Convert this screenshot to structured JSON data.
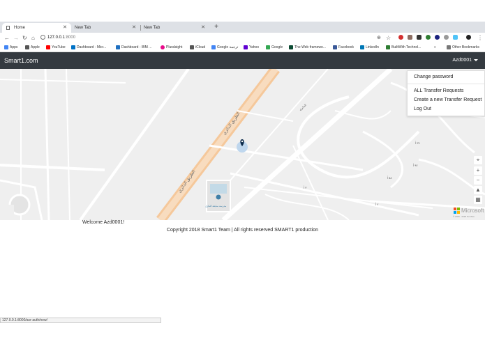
{
  "browser": {
    "tabs": [
      {
        "title": "Home",
        "active": true
      },
      {
        "title": "New Tab",
        "active": false
      },
      {
        "title": "New Tab",
        "active": false
      }
    ],
    "new_tab_symbol": "+",
    "url_host": "127.0.0.1",
    "url_port": ":8000",
    "bookmarks": [
      {
        "label": "Apps",
        "icon": "apps-grid-icon",
        "color": "#4285f4"
      },
      {
        "label": "Apple",
        "icon": "apple-icon",
        "color": "#555555"
      },
      {
        "label": "YouTube",
        "icon": "youtube-icon",
        "color": "#ff0000"
      },
      {
        "label": "Dashboard - Micr...",
        "icon": "azure-icon",
        "color": "#0072c6"
      },
      {
        "label": "Dashboard - IBM ...",
        "icon": "ibm-icon",
        "color": "#1f70c1"
      },
      {
        "label": "Pluralsight",
        "icon": "pluralsight-icon",
        "color": "#e80a89"
      },
      {
        "label": "iCloud",
        "icon": "icloud-icon",
        "color": "#555555"
      },
      {
        "label": "Google ترجمة",
        "icon": "google-translate-icon",
        "color": "#4285f4"
      },
      {
        "label": "Yahoo",
        "icon": "yahoo-icon",
        "color": "#6001d2"
      },
      {
        "label": "Google",
        "icon": "google-icon",
        "color": "#34a853"
      },
      {
        "label": "The Web framewo...",
        "icon": "web-framework-icon",
        "color": "#0c4b33"
      },
      {
        "label": "Facebook",
        "icon": "facebook-icon",
        "color": "#3b5998"
      },
      {
        "label": "LinkedIn",
        "icon": "linkedin-icon",
        "color": "#0077b5"
      },
      {
        "label": "BuiltWith Technol...",
        "icon": "builtwith-icon",
        "color": "#2e7d32"
      }
    ],
    "other_bookmarks": "Other Bookmarks",
    "status_url": "127.0.0.1:8000/asr-auth/new/"
  },
  "app": {
    "brand": "Smart1.com",
    "user": "Azd0001",
    "dropdown": [
      "Change password",
      "ALL Transfer Requests",
      "Create a new Transfer Request",
      "Log Out"
    ],
    "welcome": "Welcome Azd0001!",
    "copyright": "Copyright 2018 Smart1 Team | All rights reserved SMART1 production"
  },
  "map": {
    "provider": "Microsoft",
    "copyright": "© 2020 · 2018 TomTom",
    "highway_label": "الطريق الدائري",
    "poi_label": "مدرسة سابقة التنازل",
    "street_labels": [
      "الدائري",
      "٩٧ أ",
      "٣٧ أ",
      "٥٨ أ",
      "٢ أ",
      "٣ أ"
    ]
  }
}
